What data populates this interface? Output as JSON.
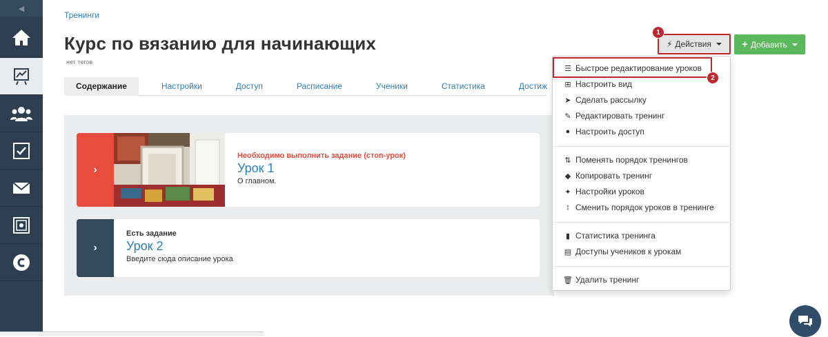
{
  "breadcrumb": "Тренинги",
  "title": "Курс по вязанию для начинающих",
  "tags": "нет тегов",
  "tabs": [
    "Содержание",
    "Настройки",
    "Доступ",
    "Расписание",
    "Ученики",
    "Статистика",
    "Достиж"
  ],
  "buttons": {
    "actions": "Действия",
    "add": "Добавить"
  },
  "badges": [
    "1",
    "2"
  ],
  "lessons": [
    {
      "status": "Необходимо выполнить задание (стоп-урок)",
      "title": "Урок 1",
      "desc": "О главном."
    },
    {
      "status": "Есть задание",
      "title": "Урок 2",
      "desc": "Введите сюда описание урока"
    }
  ],
  "menu": {
    "group1": [
      {
        "icon": "list-icon",
        "label": "Быстрое редактирование уроков"
      },
      {
        "icon": "sitemap-icon",
        "label": "Настроить вид"
      },
      {
        "icon": "send-icon",
        "label": "Сделать рассылку"
      },
      {
        "icon": "edit-icon",
        "label": "Редактировать тренинг"
      },
      {
        "icon": "user-icon",
        "label": "Настроить доступ"
      }
    ],
    "group2": [
      {
        "icon": "sort-order-icon",
        "label": "Поменять порядок тренингов"
      },
      {
        "icon": "tags-icon",
        "label": "Копировать тренинг"
      },
      {
        "icon": "wrench-icon",
        "label": "Настройки уроков"
      },
      {
        "icon": "sort-arrows-icon",
        "label": "Сменить порядок уроков в тренинге"
      }
    ],
    "group3": [
      {
        "icon": "bar-chart-icon",
        "label": "Статистика тренинга"
      },
      {
        "icon": "table-icon",
        "label": "Доступы учеников к урокам"
      }
    ],
    "group4": [
      {
        "icon": "trash-icon",
        "label": "Удалить тренинг"
      }
    ]
  },
  "colors": {
    "sidebar": "#2d3e50",
    "accent_link": "#2c7fb8",
    "danger": "#e74c3c",
    "highlight": "#c0272d",
    "add_button": "#5cb85c"
  }
}
